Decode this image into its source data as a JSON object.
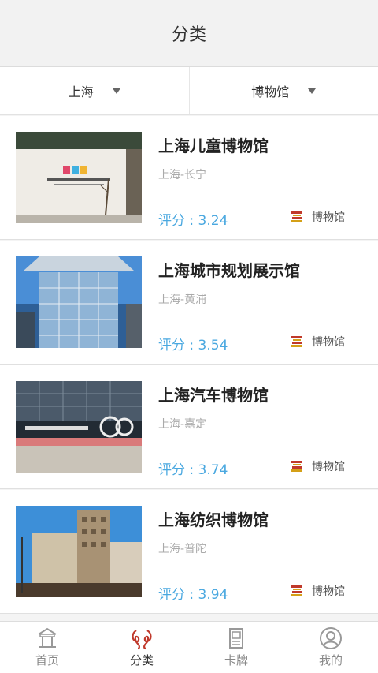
{
  "header": {
    "title": "分类"
  },
  "filters": [
    {
      "label": "上海"
    },
    {
      "label": "博物馆"
    }
  ],
  "items": [
    {
      "name": "上海儿童博物馆",
      "location": "上海-长宁",
      "score": "评分 : 3.24",
      "category": "博物馆",
      "image": "childrens-museum-photo"
    },
    {
      "name": "上海城市规划展示馆",
      "location": "上海-黄浦",
      "score": "评分 : 3.54",
      "category": "博物馆",
      "image": "urban-planning-hall-photo"
    },
    {
      "name": "上海汽车博物馆",
      "location": "上海-嘉定",
      "score": "评分 : 3.74",
      "category": "博物馆",
      "image": "auto-museum-photo"
    },
    {
      "name": "上海纺织博物馆",
      "location": "上海-普陀",
      "score": "评分 : 3.94",
      "category": "博物馆",
      "image": "textile-museum-photo"
    }
  ],
  "tabs": [
    {
      "label": "首页",
      "icon": "home-icon",
      "active": false
    },
    {
      "label": "分类",
      "icon": "category-icon",
      "active": true
    },
    {
      "label": "卡牌",
      "icon": "card-icon",
      "active": false
    },
    {
      "label": "我的",
      "icon": "profile-icon",
      "active": false
    }
  ],
  "colors": {
    "accent": "#4aa8e0",
    "active_tab": "#c0392b",
    "background": "#f4f4f4"
  }
}
